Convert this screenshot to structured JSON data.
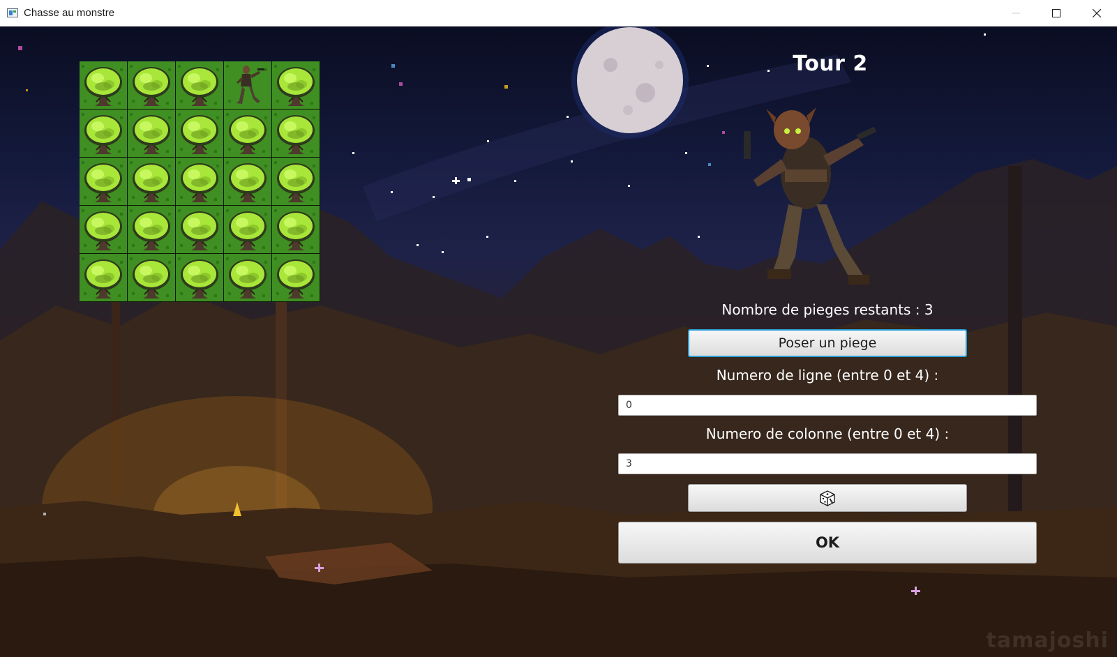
{
  "window": {
    "title": "Chasse au monstre",
    "app_icon": "app-window-icon",
    "controls": [
      "minimize-icon",
      "maximize-icon",
      "close-icon"
    ]
  },
  "game": {
    "turn_title": "Tour 2",
    "grid": {
      "rows": 5,
      "cols": 5,
      "cells": [
        [
          "tree",
          "tree",
          "tree",
          "hunter",
          "tree"
        ],
        [
          "tree",
          "tree",
          "tree",
          "tree",
          "tree"
        ],
        [
          "tree",
          "tree",
          "tree",
          "tree",
          "tree"
        ],
        [
          "tree",
          "tree",
          "tree",
          "tree",
          "tree"
        ],
        [
          "tree",
          "tree",
          "tree",
          "tree",
          "tree"
        ]
      ]
    },
    "traps_label": "Nombre de pieges restants : 3",
    "place_trap_button": "Poser un piege",
    "row_label": "Numero de ligne (entre 0 et 4) :",
    "row_value": "0",
    "col_label": "Numero de colonne (entre 0 et 4) :",
    "col_value": "3",
    "dice_button_icon": "dice-icon",
    "ok_button": "OK",
    "watermark": "tamajoshi"
  },
  "colors": {
    "grass": "#3f8f22",
    "tree_foliage": "#a8e63a",
    "focus_border": "#2a9fd6",
    "sky": "#0a0d22"
  }
}
